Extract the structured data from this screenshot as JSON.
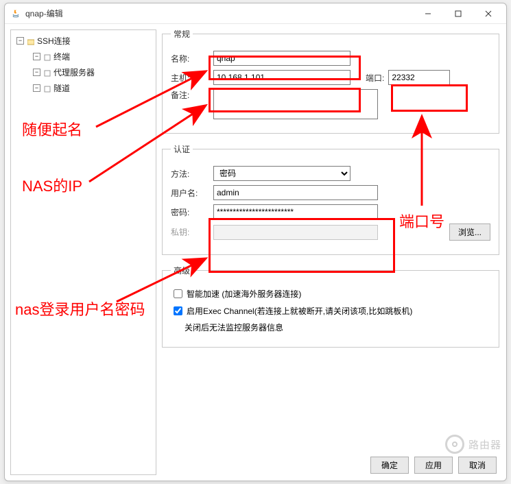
{
  "window": {
    "title": "qnap-编辑"
  },
  "sidebar": {
    "root": "SSH连接",
    "items": [
      {
        "label": "终端"
      },
      {
        "label": "代理服务器"
      },
      {
        "label": "隧道"
      }
    ]
  },
  "general": {
    "legend": "常规",
    "name_label": "名称:",
    "name_value": "qnap",
    "host_label": "主机:",
    "host_value": "10.168.1.101",
    "port_label": "端口:",
    "port_value": "22332",
    "note_label": "备注:",
    "note_value": ""
  },
  "auth": {
    "legend": "认证",
    "method_label": "方法:",
    "method_value": "密码",
    "user_label": "用户名:",
    "user_value": "admin",
    "pass_label": "密码:",
    "pass_value": "************************",
    "key_label": "私钥:",
    "key_value": "",
    "browse": "浏览..."
  },
  "advanced": {
    "legend": "高级",
    "smart_accel": "智能加速 (加速海外服务器连接)",
    "smart_accel_checked": false,
    "exec_channel": "启用Exec Channel(若连接上就被断开,请关闭该项,比如跳板机)",
    "exec_channel_hint": "关闭后无法监控服务器信息",
    "exec_channel_checked": true
  },
  "footer": {
    "ok": "确定",
    "apply": "应用",
    "cancel": "取消"
  },
  "annotations": {
    "name_hint": "随便起名",
    "ip_hint": "NAS的IP",
    "port_hint": "端口号",
    "cred_hint": "nas登录用户名密码"
  },
  "watermark": "路由器"
}
